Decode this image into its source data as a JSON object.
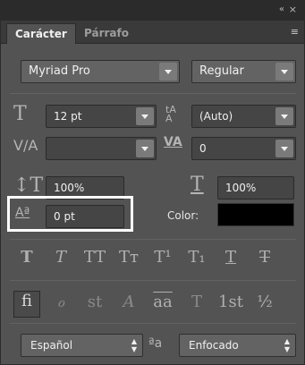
{
  "window": {
    "collapse_icon": "«",
    "close_icon": "×"
  },
  "tabs": [
    {
      "label": "Carácter",
      "active": true
    },
    {
      "label": "Párrafo",
      "active": false
    }
  ],
  "panel_menu_icon": "≡",
  "font": {
    "family": "Myriad Pro",
    "style": "Regular"
  },
  "size": {
    "value": "12 pt"
  },
  "leading": {
    "value": "(Auto)"
  },
  "kerning": {
    "value": ""
  },
  "tracking": {
    "value": "0"
  },
  "vertical_scale": {
    "value": "100%"
  },
  "horizontal_scale": {
    "value": "100%"
  },
  "baseline_shift": {
    "value": "0 pt"
  },
  "color": {
    "label": "Color:",
    "swatch": "#000000"
  },
  "type_styles": [
    "T",
    "T",
    "TT",
    "Tт",
    "T¹",
    "T₁",
    "T",
    "T"
  ],
  "opentype": [
    "fi",
    "ℴ",
    "st",
    "A",
    "aa",
    "T",
    "1st",
    "½"
  ],
  "language": {
    "value": "Español"
  },
  "antialias": {
    "icon": "ªa",
    "value": "Enfocado"
  }
}
